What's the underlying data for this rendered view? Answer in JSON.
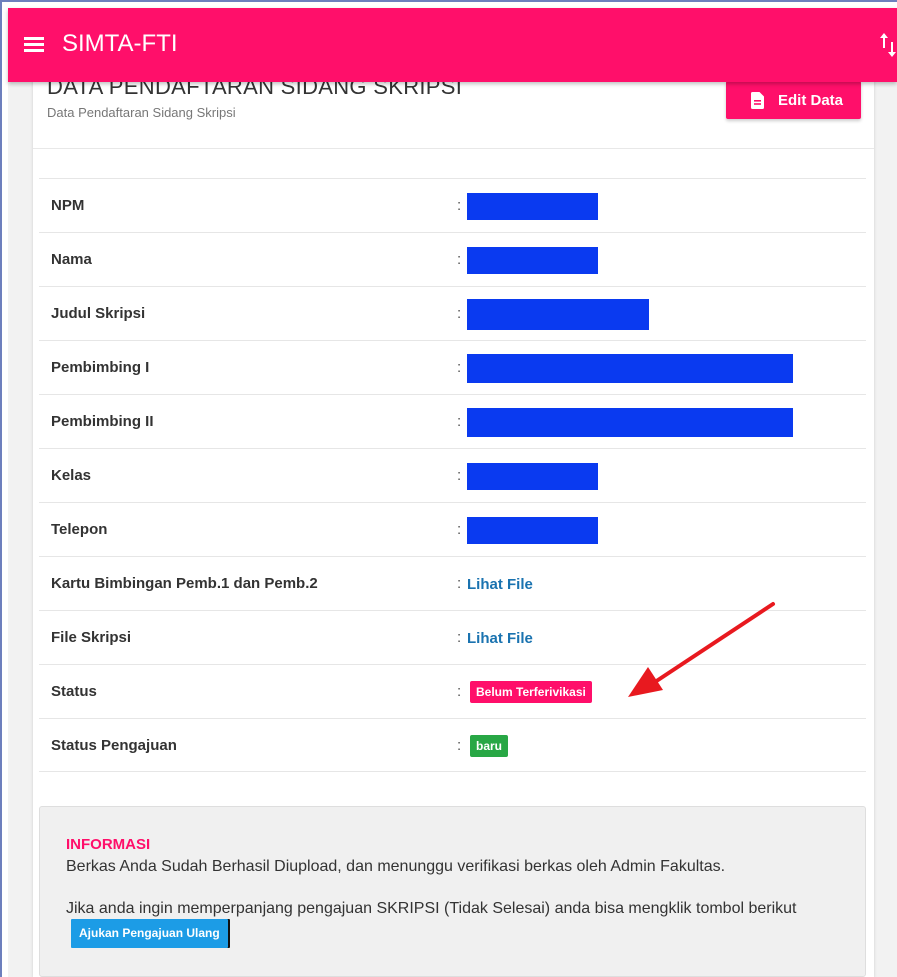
{
  "appbar": {
    "title": "SIMTA-FTI"
  },
  "card": {
    "heading": "DATA PENDAFTARAN SIDANG SKRIPSI",
    "subheading": "Data Pendaftaran Sidang Skripsi",
    "edit_button_label": "Edit Data"
  },
  "table": {
    "colon": ":",
    "rows": [
      {
        "label": "NPM"
      },
      {
        "label": "Nama"
      },
      {
        "label": "Judul Skripsi"
      },
      {
        "label": "Pembimbing I"
      },
      {
        "label": "Pembimbing II"
      },
      {
        "label": "Kelas"
      },
      {
        "label": "Telepon"
      },
      {
        "label": "Kartu Bimbingan Pemb.1 dan Pemb.2",
        "value": "Lihat File"
      },
      {
        "label": "File Skripsi",
        "value": "Lihat File"
      },
      {
        "label": "Status",
        "value": "Belum Terferivikasi"
      },
      {
        "label": "Status Pengajuan",
        "value": "baru"
      }
    ]
  },
  "info": {
    "title": "INFORMASI",
    "line1": "Berkas Anda Sudah Berhasil Diupload, dan menunggu verifikasi berkas oleh Admin Fakultas.",
    "line2": "Jika anda ingin memperpanjang pengajuan SKRIPSI (Tidak Selesai) anda bisa mengklik tombol berikut",
    "button_label": "Ajukan Pengajuan Ulang"
  },
  "icons": {
    "menu": "hamburger-menu-icon",
    "sort": "sort-arrows-icon",
    "edit": "document-icon"
  },
  "colors": {
    "primary": "#ff0f6a",
    "redaction": "#0a3af0",
    "link": "#1a73b0",
    "success": "#28a745",
    "button_blue": "#1c9ce6",
    "annotation_arrow": "#e8191f"
  }
}
